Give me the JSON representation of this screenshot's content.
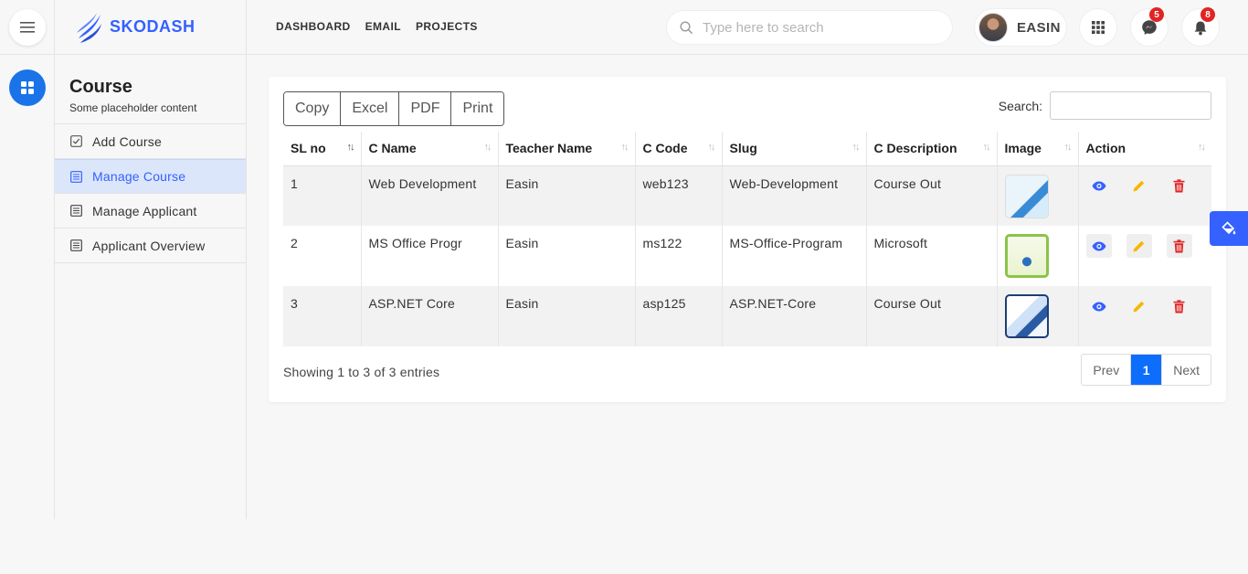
{
  "brand": {
    "name": "SKODASH"
  },
  "nav": [
    "DASHBOARD",
    "EMAIL",
    "PROJECTS"
  ],
  "search": {
    "placeholder": "Type here to search"
  },
  "user": {
    "name": "EASIN"
  },
  "badges": {
    "messages": "5",
    "notifications": "8"
  },
  "section": {
    "title": "Course",
    "subtitle": "Some placeholder content"
  },
  "sidebar": {
    "items": [
      {
        "label": "Add Course",
        "icon": "check-square-icon"
      },
      {
        "label": "Manage Course",
        "icon": "list-icon"
      },
      {
        "label": "Manage Applicant",
        "icon": "list-icon"
      },
      {
        "label": "Applicant Overview",
        "icon": "list-icon"
      }
    ]
  },
  "toolbar": {
    "copy": "Copy",
    "excel": "Excel",
    "pdf": "PDF",
    "print": "Print",
    "search_label": "Search:"
  },
  "table": {
    "headers": [
      "SL no",
      "C Name",
      "Teacher Name",
      "C Code",
      "Slug",
      "C Description",
      "Image",
      "Action"
    ],
    "rows": [
      [
        "1",
        "Web Development",
        "Easin",
        "web123",
        "Web-Development",
        "Course Out"
      ],
      [
        "2",
        "MS Office Progr",
        "Easin",
        "ms122",
        "MS-Office-Program",
        "Microsoft"
      ],
      [
        "3",
        "ASP.NET Core",
        "Easin",
        "asp125",
        "ASP.NET-Core",
        "Course Out"
      ]
    ]
  },
  "footer": {
    "info": "Showing 1 to 3 of 3 entries",
    "prev": "Prev",
    "page": "1",
    "next": "Next"
  },
  "colors": {
    "accent": "#3461ff",
    "danger": "#e02424",
    "warning": "#f5b800",
    "page_active": "#0d6efd"
  }
}
